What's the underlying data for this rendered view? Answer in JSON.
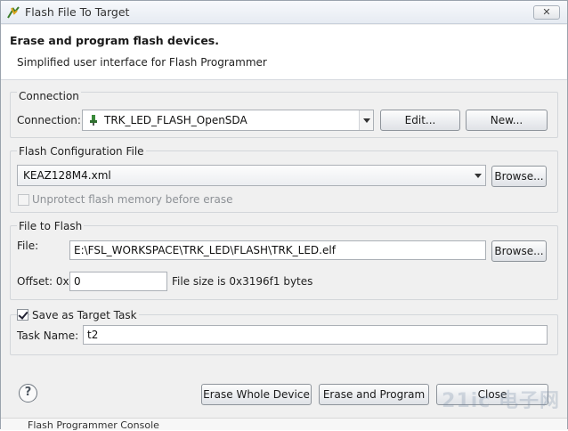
{
  "window": {
    "title": "Flash File To Target",
    "close_label": "✕"
  },
  "header": {
    "title": "Erase and program flash devices.",
    "subtitle": "Simplified user interface for Flash Programmer"
  },
  "connection": {
    "group_label": "Connection",
    "field_label": "Connection:",
    "value": "TRK_LED_FLASH_OpenSDA",
    "edit_label": "Edit...",
    "new_label": "New..."
  },
  "flash_config": {
    "group_label": "Flash Configuration File",
    "value": "KEAZ128M4.xml",
    "browse_label": "Browse...",
    "unprotect_label": "Unprotect flash memory before erase",
    "unprotect_checked": false
  },
  "file_to_flash": {
    "group_label": "File to Flash",
    "file_label": "File:",
    "file_value": "E:\\FSL_WORKSPACE\\TRK_LED\\FLASH\\TRK_LED.elf",
    "browse_label": "Browse...",
    "offset_label": "Offset: 0x",
    "offset_value": "0",
    "size_text": "File size is 0x3196f1 bytes"
  },
  "target_task": {
    "save_label": "Save as Target Task",
    "save_checked": true,
    "task_name_label": "Task Name:",
    "task_name_value": "t2"
  },
  "footer": {
    "help_label": "?",
    "erase_whole_label": "Erase Whole Device",
    "erase_program_label": "Erase and Program",
    "close_label": "Close",
    "bottom_text": "Flash Programmer Console"
  },
  "watermark": "21ic 电子网"
}
